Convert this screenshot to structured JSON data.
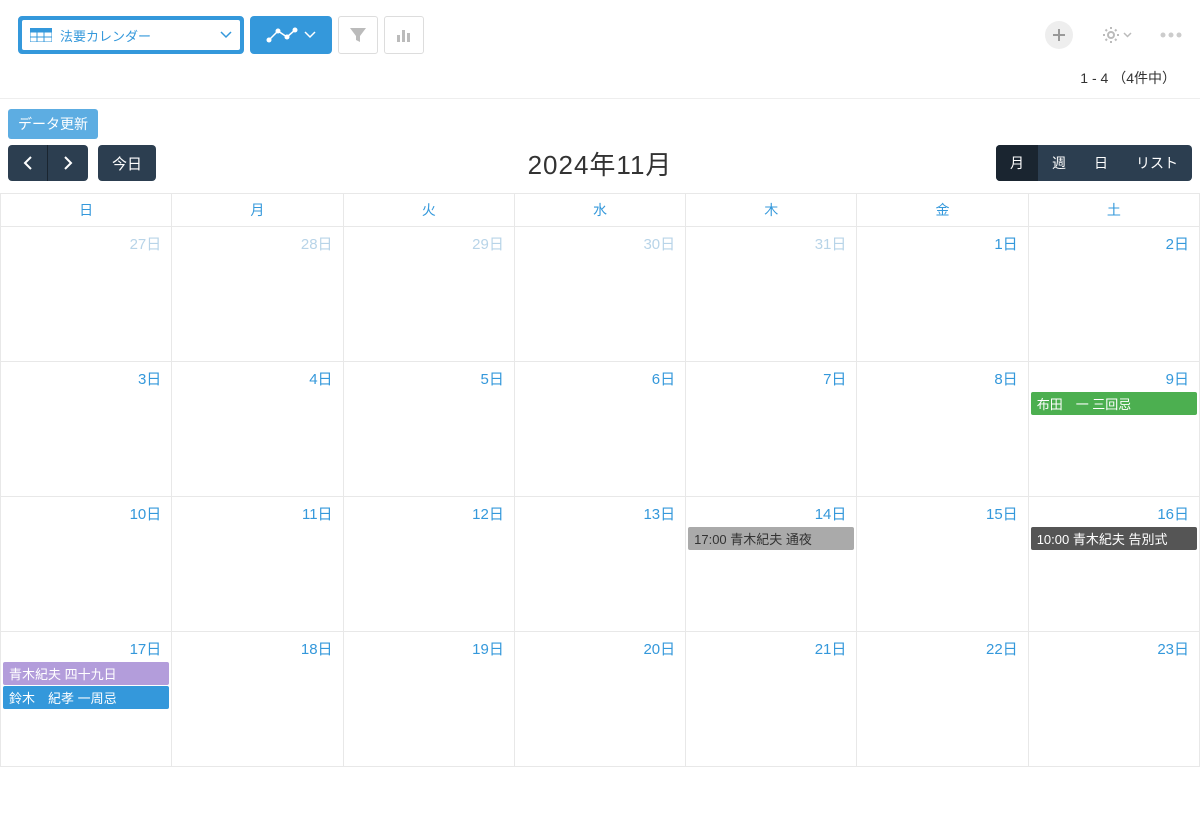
{
  "toolbar": {
    "view_name": "法要カレンダー"
  },
  "count_text": "1 - 4 （4件中）",
  "refresh_label": "データ更新",
  "nav": {
    "today_label": "今日",
    "title": "2024年11月",
    "views": {
      "month": "月",
      "week": "週",
      "day": "日",
      "list": "リスト"
    }
  },
  "weekdays": [
    "日",
    "月",
    "火",
    "水",
    "木",
    "金",
    "土"
  ],
  "weeks": [
    [
      {
        "num": "27日",
        "muted": true
      },
      {
        "num": "28日",
        "muted": true
      },
      {
        "num": "29日",
        "muted": true
      },
      {
        "num": "30日",
        "muted": true
      },
      {
        "num": "31日",
        "muted": true
      },
      {
        "num": "1日"
      },
      {
        "num": "2日"
      }
    ],
    [
      {
        "num": "3日"
      },
      {
        "num": "4日"
      },
      {
        "num": "5日"
      },
      {
        "num": "6日"
      },
      {
        "num": "7日"
      },
      {
        "num": "8日"
      },
      {
        "num": "9日",
        "events": [
          {
            "text": "布田　一 三回忌",
            "cls": "ev-green"
          }
        ]
      }
    ],
    [
      {
        "num": "10日"
      },
      {
        "num": "11日"
      },
      {
        "num": "12日"
      },
      {
        "num": "13日"
      },
      {
        "num": "14日",
        "events": [
          {
            "text": "17:00 青木紀夫 通夜",
            "cls": "ev-gray"
          }
        ]
      },
      {
        "num": "15日"
      },
      {
        "num": "16日",
        "events": [
          {
            "text": "10:00 青木紀夫 告別式",
            "cls": "ev-dark"
          }
        ]
      }
    ],
    [
      {
        "num": "17日",
        "events": [
          {
            "text": "青木紀夫 四十九日",
            "cls": "ev-purple"
          },
          {
            "text": "鈴木　紀孝 一周忌",
            "cls": "ev-blue"
          }
        ]
      },
      {
        "num": "18日"
      },
      {
        "num": "19日"
      },
      {
        "num": "20日"
      },
      {
        "num": "21日"
      },
      {
        "num": "22日"
      },
      {
        "num": "23日"
      }
    ]
  ]
}
